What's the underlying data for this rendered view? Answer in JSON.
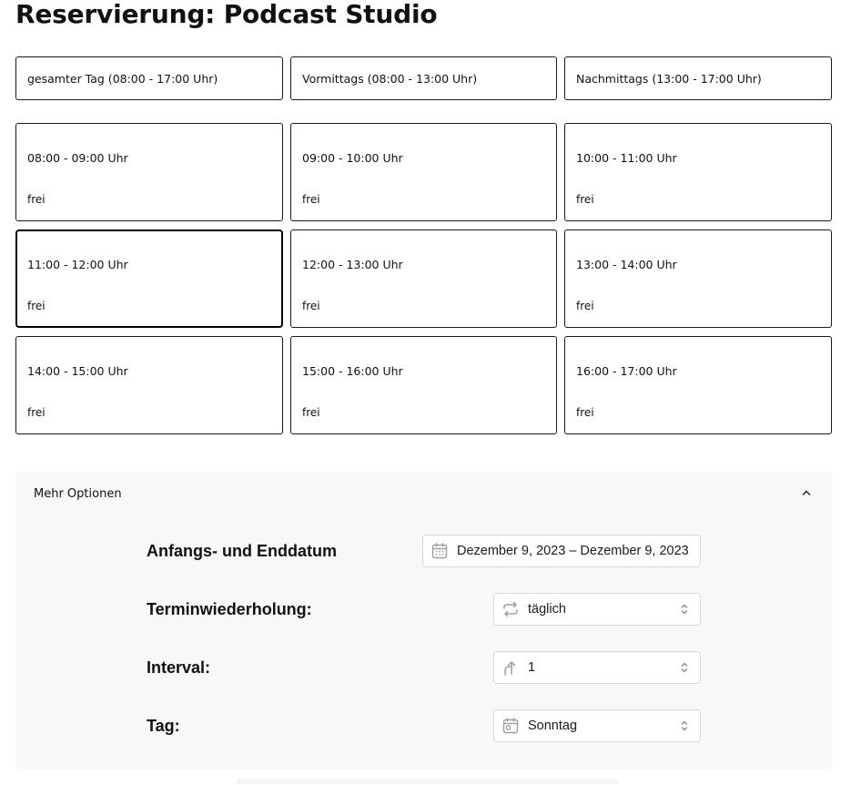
{
  "page": {
    "title": "Reservierung: Podcast Studio"
  },
  "ranges": [
    {
      "label": "gesamter Tag (08:00 - 17:00 Uhr)"
    },
    {
      "label": "Vormittags (08:00 - 13:00 Uhr)"
    },
    {
      "label": "Nachmittags (13:00 - 17:00 Uhr)"
    }
  ],
  "slots": [
    {
      "time": "08:00 - 09:00 Uhr",
      "status": "frei"
    },
    {
      "time": "09:00 - 10:00 Uhr",
      "status": "frei"
    },
    {
      "time": "10:00 - 11:00 Uhr",
      "status": "frei"
    },
    {
      "time": "11:00 - 12:00 Uhr",
      "status": "frei",
      "selected": true
    },
    {
      "time": "12:00 - 13:00 Uhr",
      "status": "frei"
    },
    {
      "time": "13:00 - 14:00 Uhr",
      "status": "frei"
    },
    {
      "time": "14:00 - 15:00 Uhr",
      "status": "frei"
    },
    {
      "time": "15:00 - 16:00 Uhr",
      "status": "frei"
    },
    {
      "time": "16:00 - 17:00 Uhr",
      "status": "frei"
    }
  ],
  "options": {
    "title": "Mehr Optionen",
    "expanded": true,
    "date_range": {
      "label": "Anfangs- und Enddatum",
      "value": "Dezember 9, 2023 – Dezember 9, 2023",
      "icon": "calendar-icon"
    },
    "repeat": {
      "label": "Terminwiederholung:",
      "value": "täglich",
      "icon": "repeat-icon"
    },
    "interval": {
      "label": "Interval:",
      "value": "1",
      "icon": "interval-arrow-icon"
    },
    "day": {
      "label": "Tag:",
      "value": "Sonntag",
      "icon": "calendar-icon"
    }
  },
  "colors": {
    "border": "#1a1a1a",
    "panel_bg": "#f7f8fa",
    "control_border": "#d4d7dd",
    "icon_gray": "#9aa0a8"
  }
}
